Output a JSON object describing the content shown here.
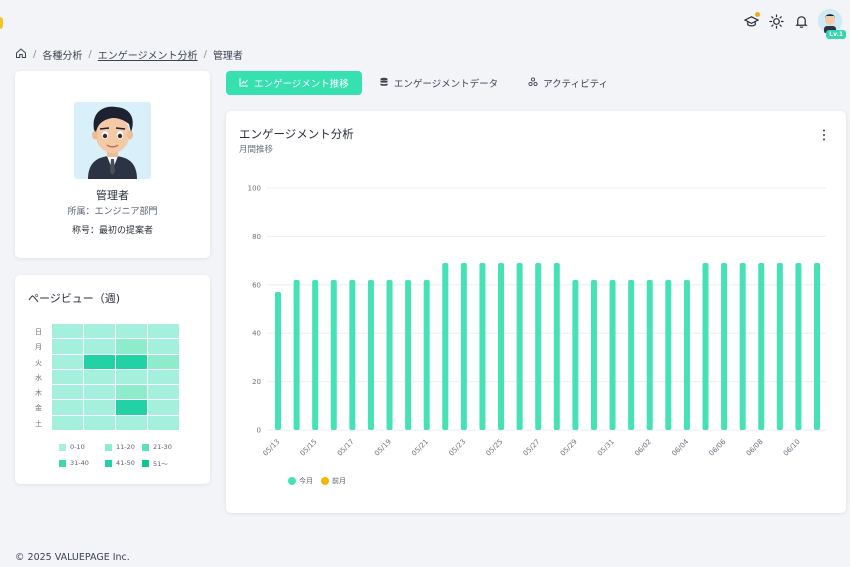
{
  "breadcrumb": {
    "items": [
      "各種分析",
      "エンゲージメント分析",
      "管理者"
    ]
  },
  "header": {
    "level_badge": "Lv.1",
    "icons": [
      "graduation-cap-icon",
      "sun-icon",
      "bell-icon"
    ]
  },
  "profile": {
    "name": "管理者",
    "department": "所属：エンジニア部門",
    "title": "称号：最初の提案者"
  },
  "heatmap": {
    "title": "ページビュー（週)",
    "rows": [
      "日",
      "月",
      "火",
      "水",
      "木",
      "金",
      "土"
    ],
    "levels": [
      [
        1,
        1,
        1,
        1
      ],
      [
        1,
        1,
        2,
        1
      ],
      [
        1,
        5,
        5,
        2
      ],
      [
        1,
        1,
        1,
        1
      ],
      [
        1,
        1,
        2,
        1
      ],
      [
        1,
        1,
        5,
        1
      ],
      [
        1,
        1,
        1,
        1
      ]
    ],
    "legend": [
      "0-10",
      "11-20",
      "21-30",
      "31-40",
      "41-50",
      "51～"
    ],
    "colors": [
      "#a4f0dc",
      "#8eeccd",
      "#5fe0bd",
      "#3fd9b0",
      "#22d1a4",
      "#0fc497"
    ]
  },
  "tabs": [
    {
      "label": "エンゲージメント推移",
      "icon": "line-chart-icon",
      "active": true
    },
    {
      "label": "エンゲージメントデータ",
      "icon": "database-icon",
      "active": false
    },
    {
      "label": "アクティビティ",
      "icon": "users-icon",
      "active": false
    }
  ],
  "chart": {
    "title": "エンゲージメント分析",
    "subtitle": "月間推移"
  },
  "chart_data": {
    "type": "bar",
    "ylim": [
      0,
      100
    ],
    "yticks": [
      0,
      20,
      40,
      60,
      80,
      100
    ],
    "categories": [
      "05/13",
      "05/14",
      "05/15",
      "05/16",
      "05/17",
      "05/18",
      "05/19",
      "05/20",
      "05/21",
      "05/22",
      "05/23",
      "05/24",
      "05/25",
      "05/26",
      "05/27",
      "05/28",
      "05/29",
      "05/30",
      "05/31",
      "06/01",
      "06/02",
      "06/03",
      "06/04",
      "06/05",
      "06/06",
      "06/07",
      "06/08",
      "06/09",
      "06/10",
      "06/11"
    ],
    "xtick_labels": [
      "05/13",
      "05/15",
      "05/17",
      "05/19",
      "05/21",
      "05/23",
      "05/25",
      "05/27",
      "05/29",
      "05/31",
      "06/02",
      "06/04",
      "06/06",
      "06/08",
      "06/10"
    ],
    "series": [
      {
        "name": "今月",
        "color": "#45e2b6",
        "values": [
          57,
          62,
          62,
          62,
          62,
          62,
          62,
          62,
          62,
          69,
          69,
          69,
          69,
          69,
          69,
          69,
          62,
          62,
          62,
          62,
          62,
          62,
          62,
          69,
          69,
          69,
          69,
          69,
          69,
          69
        ]
      },
      {
        "name": "前月",
        "color": "#f7b400",
        "values": []
      }
    ],
    "grid": true,
    "legend_position": "bottom-left"
  },
  "footer": {
    "copyright": "© 2025  VALUEPAGE Inc."
  }
}
